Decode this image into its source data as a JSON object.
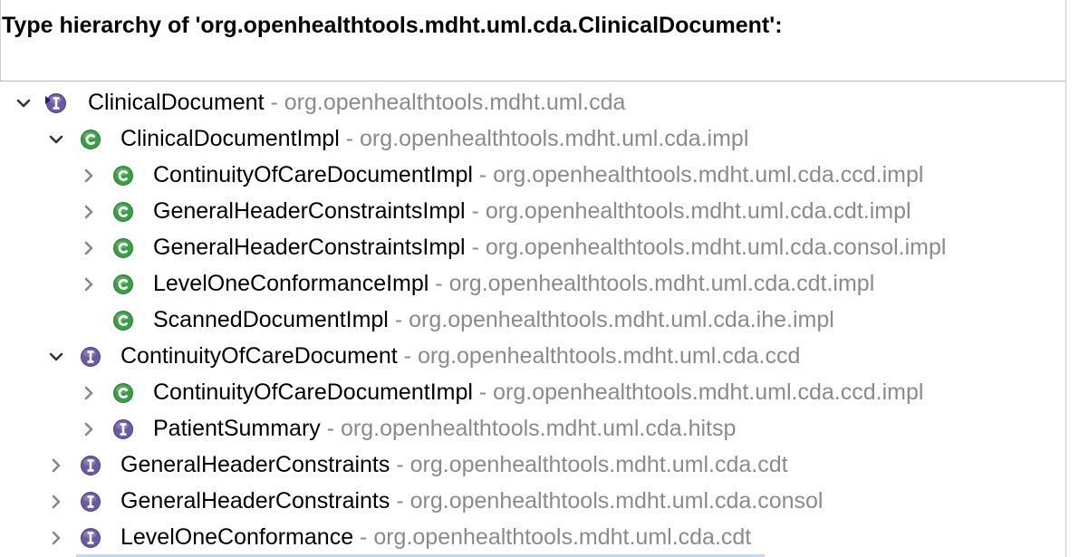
{
  "header": {
    "title": "Type hierarchy of 'org.openhealthtools.mdht.uml.cda.ClinicalDocument':"
  },
  "colors": {
    "class_icon": "#3a9e44",
    "interface_icon": "#6a5aa6",
    "qualifier_text": "#8a8a8a"
  },
  "tree": {
    "separator": "-",
    "rows": [
      {
        "name": "ClinicalDocument",
        "qualifier": "org.openhealthtools.mdht.uml.cda",
        "kind": "interface-focus",
        "twisty": "expanded",
        "depth": 0
      },
      {
        "name": "ClinicalDocumentImpl",
        "qualifier": "org.openhealthtools.mdht.uml.cda.impl",
        "kind": "class",
        "twisty": "expanded",
        "depth": 1
      },
      {
        "name": "ContinuityOfCareDocumentImpl",
        "qualifier": "org.openhealthtools.mdht.uml.cda.ccd.impl",
        "kind": "class",
        "twisty": "collapsed",
        "depth": 2
      },
      {
        "name": "GeneralHeaderConstraintsImpl",
        "qualifier": "org.openhealthtools.mdht.uml.cda.cdt.impl",
        "kind": "class",
        "twisty": "collapsed",
        "depth": 2
      },
      {
        "name": "GeneralHeaderConstraintsImpl",
        "qualifier": "org.openhealthtools.mdht.uml.cda.consol.impl",
        "kind": "class",
        "twisty": "collapsed",
        "depth": 2
      },
      {
        "name": "LevelOneConformanceImpl",
        "qualifier": "org.openhealthtools.mdht.uml.cda.cdt.impl",
        "kind": "class",
        "twisty": "collapsed",
        "depth": 2
      },
      {
        "name": "ScannedDocumentImpl",
        "qualifier": "org.openhealthtools.mdht.uml.cda.ihe.impl",
        "kind": "class",
        "twisty": "none",
        "depth": 2
      },
      {
        "name": "ContinuityOfCareDocument",
        "qualifier": "org.openhealthtools.mdht.uml.cda.ccd",
        "kind": "interface",
        "twisty": "expanded",
        "depth": 1
      },
      {
        "name": "ContinuityOfCareDocumentImpl",
        "qualifier": "org.openhealthtools.mdht.uml.cda.ccd.impl",
        "kind": "class",
        "twisty": "collapsed",
        "depth": 2
      },
      {
        "name": "PatientSummary",
        "qualifier": "org.openhealthtools.mdht.uml.cda.hitsp",
        "kind": "interface",
        "twisty": "collapsed",
        "depth": 2
      },
      {
        "name": "GeneralHeaderConstraints",
        "qualifier": "org.openhealthtools.mdht.uml.cda.cdt",
        "kind": "interface",
        "twisty": "collapsed",
        "depth": 1
      },
      {
        "name": "GeneralHeaderConstraints",
        "qualifier": "org.openhealthtools.mdht.uml.cda.consol",
        "kind": "interface",
        "twisty": "collapsed",
        "depth": 1
      },
      {
        "name": "LevelOneConformance",
        "qualifier": "org.openhealthtools.mdht.uml.cda.cdt",
        "kind": "interface",
        "twisty": "collapsed",
        "depth": 1
      }
    ]
  }
}
